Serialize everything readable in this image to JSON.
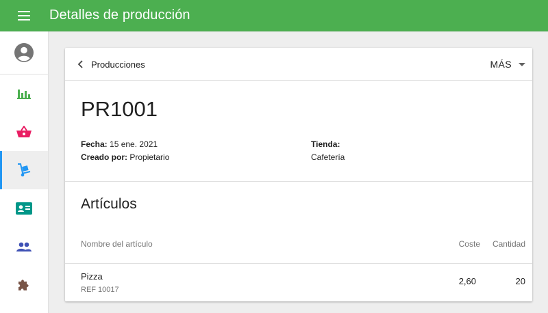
{
  "appbar": {
    "title": "Detalles de producción",
    "color": "#4caf50"
  },
  "sidebar": {
    "items": [
      {
        "name": "account",
        "icon": "account-circle-icon",
        "color": "#757575"
      },
      {
        "name": "reports",
        "icon": "bar-chart-icon",
        "color": "#4caf50"
      },
      {
        "name": "sales",
        "icon": "basket-icon",
        "color": "#e91e63"
      },
      {
        "name": "inventory",
        "icon": "hand-truck-icon",
        "color": "#2196f3",
        "active": true
      },
      {
        "name": "employees",
        "icon": "id-card-icon",
        "color": "#009688"
      },
      {
        "name": "customers",
        "icon": "people-icon",
        "color": "#3f51b5"
      },
      {
        "name": "apps",
        "icon": "puzzle-icon",
        "color": "#795548"
      }
    ]
  },
  "card": {
    "back_label": "Producciones",
    "more_label": "MÁS",
    "doc_number": "PR1001",
    "date_label": "Fecha:",
    "date_value": "15 ene. 2021",
    "created_label": "Creado por:",
    "created_value": "Propietario",
    "store_label": "Tienda:",
    "store_value": "Cafetería",
    "section_title": "Artículos",
    "columns": {
      "name": "Nombre del artículo",
      "cost": "Coste",
      "quantity": "Cantidad"
    },
    "rows": [
      {
        "name": "Pizza",
        "ref": "REF 10017",
        "cost": "2,60",
        "quantity": "20"
      }
    ]
  }
}
